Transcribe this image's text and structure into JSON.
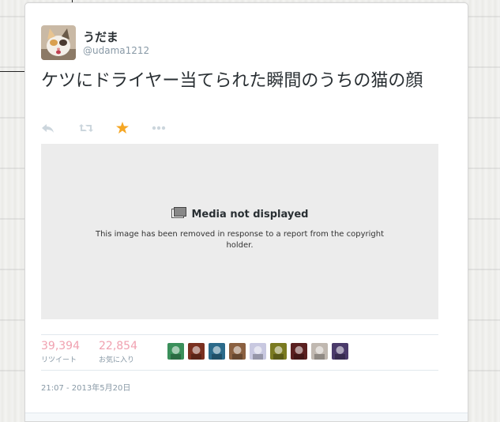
{
  "tweet": {
    "display_name": "うだま",
    "screen_name": "@udama1212",
    "text": "ケツにドライヤー当てられた瞬間のうちの猫の顔",
    "timestamp": "21:07 - 2013年5月20日"
  },
  "actions": {
    "reply_icon": "reply-icon",
    "retweet_icon": "retweet-icon",
    "favorite_icon": "star-icon",
    "more_icon": "more-dots-icon",
    "favorite_color": "#f5a623"
  },
  "media": {
    "title": "Media not displayed",
    "description": "This image has been removed in response to a report from the copyright holder."
  },
  "stats": {
    "retweets": {
      "count": "39,394",
      "label": "リツイート"
    },
    "favorites": {
      "count": "22,854",
      "label": "お気に入り"
    }
  },
  "favoriters": [
    {
      "name": "favoriter-avatar-1",
      "color": "#3a8f5a"
    },
    {
      "name": "favoriter-avatar-2",
      "color": "#7a3020"
    },
    {
      "name": "favoriter-avatar-3",
      "color": "#2b6a8a"
    },
    {
      "name": "favoriter-avatar-4",
      "color": "#8a6040"
    },
    {
      "name": "favoriter-avatar-5",
      "color": "#c8c8e0"
    },
    {
      "name": "favoriter-avatar-6",
      "color": "#7a7a20"
    },
    {
      "name": "favoriter-avatar-7",
      "color": "#5a2020"
    },
    {
      "name": "favoriter-avatar-8",
      "color": "#c0b8b0"
    },
    {
      "name": "favoriter-avatar-9",
      "color": "#4a3a6a"
    }
  ]
}
